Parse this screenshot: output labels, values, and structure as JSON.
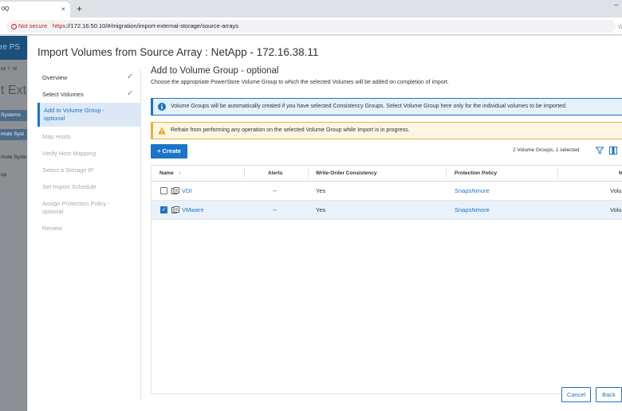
{
  "browser": {
    "tab_title": "0Q",
    "tab_close": "×",
    "new_tab": "+",
    "minimize": "–",
    "security_label": "Not secure",
    "url_scheme": "https",
    "url_rest": "://172.16.50.10/#/migration/import-external-storage/source-arrays",
    "star": "☆"
  },
  "background_app": {
    "header_fragment": "re  PS",
    "rows": [
      "rd  ⚐  N",
      "t Exte",
      "Systems",
      "mote Syst",
      "mote Syste...",
      "op"
    ]
  },
  "modal": {
    "title": "Import Volumes from Source Array : NetApp - 172.16.38.11",
    "steps": [
      {
        "label": "Overview",
        "state": "done"
      },
      {
        "label": "Select Volumes",
        "state": "done"
      },
      {
        "label": "Add to Volume Group - optional",
        "state": "active"
      },
      {
        "label": "Map Hosts",
        "state": "disabled"
      },
      {
        "label": "Verify Host Mapping",
        "state": "disabled"
      },
      {
        "label": "Select a Storage IP",
        "state": "disabled"
      },
      {
        "label": "Set Import Schedule",
        "state": "disabled"
      },
      {
        "label": "Assign Protection Policy - optional",
        "state": "disabled"
      },
      {
        "label": "Review",
        "state": "disabled"
      }
    ],
    "check_glyph": "✓",
    "section_title": "Add to Volume Group - optional",
    "section_subtitle": "Choose the appropriate PowerStore Volume Group to which the selected Volumes will be added on completion of import.",
    "info_banner": "Volume Groups will be automatically created if you have selected Consistency Groups. Select Volume Group here only for the individual volumes to be imported.",
    "warning_banner": "Refrain from performing any operation on the selected Volume Group while Import is in progress.",
    "create_button": "+ Create",
    "selection_count": "2 Volume Groups, 1 selected",
    "table": {
      "columns": [
        "Name",
        "Alerts",
        "Write-Order Consistency",
        "Protection Policy",
        "M"
      ],
      "sort_indicator": "↑",
      "rows": [
        {
          "name": "VDI",
          "alerts": "--",
          "write_order": "Yes",
          "policy": "SnapsNmore",
          "extra": "Volu",
          "selected": false
        },
        {
          "name": "VMware",
          "alerts": "--",
          "write_order": "Yes",
          "policy": "SnapsNmore",
          "extra": "Volu",
          "selected": true
        }
      ]
    },
    "cancel_button": "Cancel",
    "back_button": "Back"
  },
  "colors": {
    "accent": "#1b74c7",
    "success": "#4aa341",
    "warning": "#e3b341",
    "not_secure": "#c5221f"
  },
  "icons": [
    "info-icon",
    "warning-icon",
    "filter-icon",
    "columns-icon",
    "volume-group-icon",
    "check-icon",
    "sort-up-icon",
    "close-icon",
    "star-icon"
  ]
}
